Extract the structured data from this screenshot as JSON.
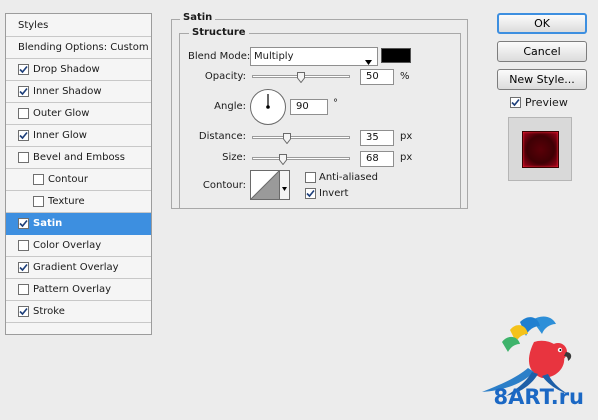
{
  "styles_panel": {
    "header": "Styles",
    "items": [
      {
        "label": "Blending Options: Custom",
        "checkbox": false
      },
      {
        "label": "Drop Shadow",
        "checked": true
      },
      {
        "label": "Inner Shadow",
        "checked": true
      },
      {
        "label": "Outer Glow",
        "checked": false
      },
      {
        "label": "Inner Glow",
        "checked": true
      },
      {
        "label": "Bevel and Emboss",
        "checked": false
      },
      {
        "label": "Contour",
        "checked": false
      },
      {
        "label": "Texture",
        "checked": false
      },
      {
        "label": "Satin",
        "checked": true,
        "selected": true
      },
      {
        "label": "Color Overlay",
        "checked": false
      },
      {
        "label": "Gradient Overlay",
        "checked": true
      },
      {
        "label": "Pattern Overlay",
        "checked": false
      },
      {
        "label": "Stroke",
        "checked": true
      }
    ]
  },
  "satin": {
    "title": "Satin",
    "structure_title": "Structure",
    "blend_mode": {
      "label": "Blend Mode:",
      "value": "Multiply",
      "color": "#000000"
    },
    "opacity": {
      "label": "Opacity:",
      "value": "50",
      "unit": "%",
      "level": 50
    },
    "angle": {
      "label": "Angle:",
      "value": "90",
      "unit": "°"
    },
    "distance": {
      "label": "Distance:",
      "value": "35",
      "unit": "px",
      "level": 35
    },
    "size": {
      "label": "Size:",
      "value": "68",
      "unit": "px",
      "level": 27
    },
    "contour": {
      "label": "Contour:"
    },
    "anti_aliased": {
      "label": "Anti-aliased",
      "checked": false
    },
    "invert": {
      "label": "Invert",
      "checked": true
    }
  },
  "buttons": {
    "ok": "OK",
    "cancel": "Cancel",
    "new_style": "New Style..."
  },
  "preview": {
    "label": "Preview",
    "checked": true
  },
  "watermark": {
    "text": "8ART.ru"
  },
  "colors": {
    "selection": "#3d8fe0",
    "preview_swatch": "#a8001b",
    "watermark": "#1b68c4"
  }
}
